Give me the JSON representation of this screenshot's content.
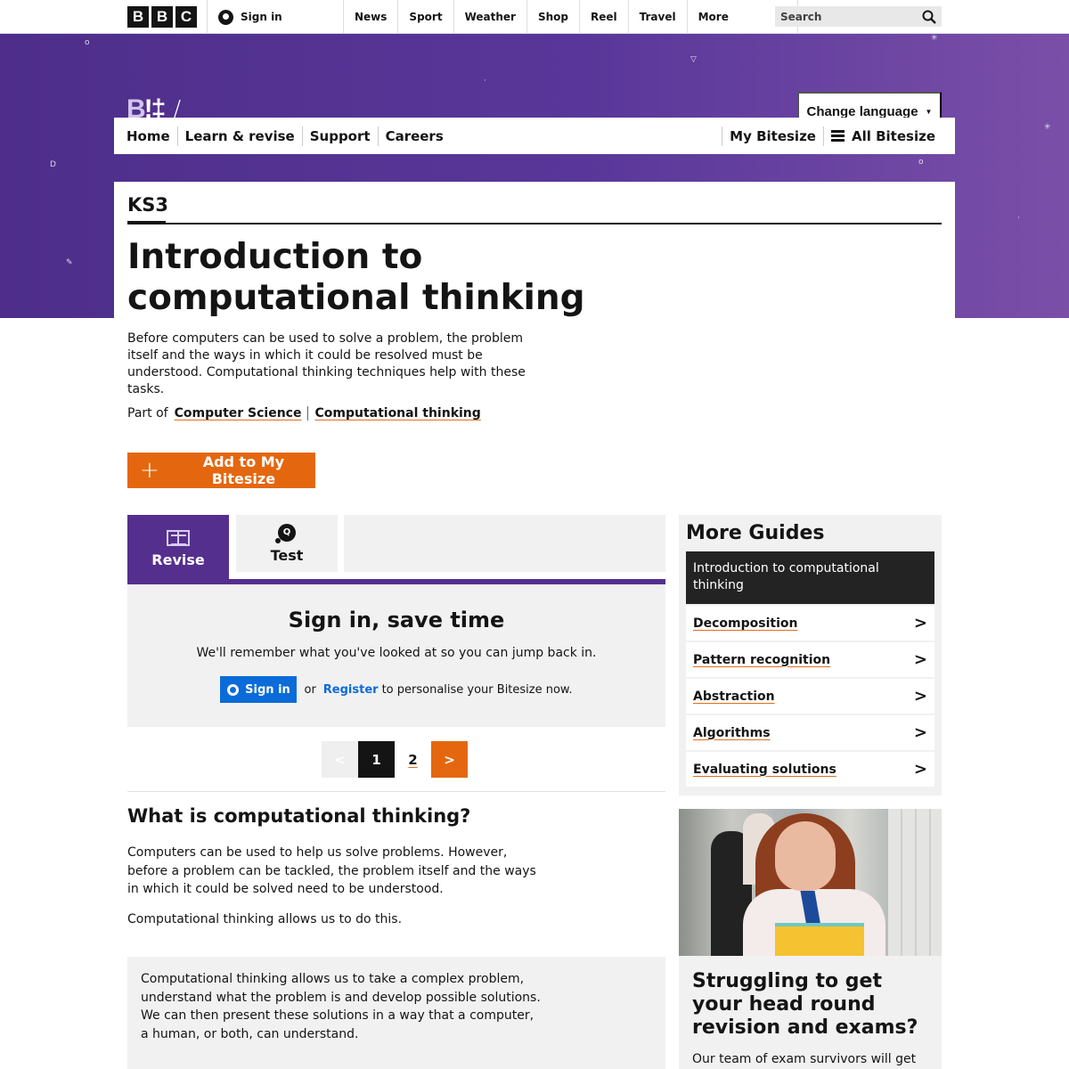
{
  "bbc_bar": {
    "logo_letters": [
      "B",
      "B",
      "C"
    ],
    "sign_in": "Sign in",
    "nav": [
      "News",
      "Sport",
      "Weather",
      "Shop",
      "Reel",
      "Travel"
    ],
    "more": "More",
    "search_placeholder": "Search"
  },
  "hero": {
    "logo_text": "Bitesize",
    "change_language": "Change language",
    "nav_left": [
      "Home",
      "Learn & revise",
      "Support",
      "Careers"
    ],
    "my_bitesize": "My Bitesize",
    "all_bitesize": "All Bitesize"
  },
  "guide": {
    "key_stage": "KS3",
    "title": "Introduction to computational thinking",
    "summary": "Before computers can be used to solve a problem, the problem itself and the ways in which it could be resolved must be understood. Computational thinking techniques help with these tasks.",
    "part_of_label": "Part of",
    "part_of_links": [
      "Computer Science",
      "Computational thinking"
    ],
    "add_button": "Add to My Bitesize"
  },
  "tabs": {
    "revise": "Revise",
    "test": "Test",
    "quiz_glyph": "Q"
  },
  "signin_panel": {
    "heading": "Sign in, save time",
    "text": "We'll remember what you've looked at so you can jump back in.",
    "button": "Sign in",
    "or": "or",
    "register": "Register",
    "suffix": "to personalise your Bitesize now."
  },
  "pagination": {
    "prev": "<",
    "pages": [
      "1",
      "2"
    ],
    "current": "1",
    "next": ">"
  },
  "article": {
    "heading": "What is computational thinking?",
    "paragraph1": "Computers can be used to help us solve problems. However, before a problem can be tackled, the problem itself and the ways in which it could be solved need to be understood.",
    "paragraph2": "Computational thinking allows us to do this.",
    "callout": "Computational thinking allows us to take a complex problem, understand what the problem is and develop possible solutions. We can then present these solutions in a way that a computer, a human, or both, can understand."
  },
  "more_guides": {
    "heading": "More Guides",
    "current": "Introduction to computational thinking",
    "items": [
      "Decomposition",
      "Pattern recognition",
      "Abstraction",
      "Algorithms",
      "Evaluating solutions"
    ],
    "chevron": ">"
  },
  "promo": {
    "heading": "Struggling to get your head round revision and exams?",
    "text": "Our team of exam survivors will get"
  },
  "colors": {
    "purple": "#552f8e",
    "orange": "#e4670f",
    "blue": "#0b6bd9",
    "dark": "#141414",
    "panel_grey": "#f1f1f1"
  }
}
